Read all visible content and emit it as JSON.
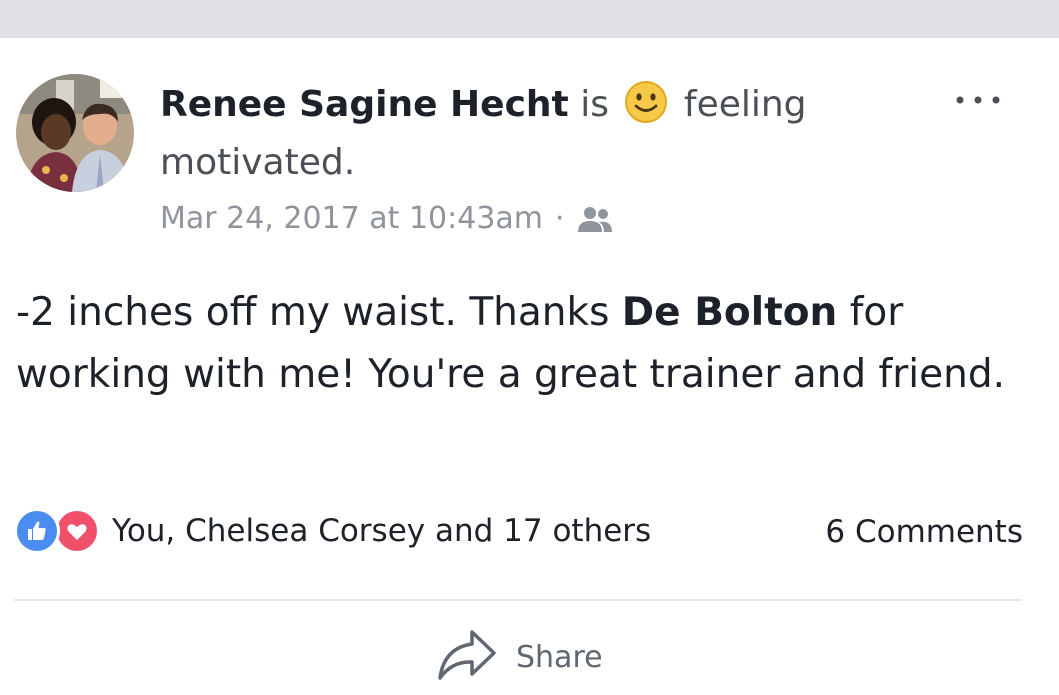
{
  "post": {
    "author": "Renee Sagine Hecht",
    "verb": "is",
    "feeling_text": "feeling motivated.",
    "timestamp": "Mar 24, 2017 at 10:43am",
    "separator": "·",
    "privacy_icon": "friends-icon",
    "text_before_mention": "-2 inches off my waist. Thanks ",
    "mention": "De Bolton",
    "text_after_mention": " for working with me! You're a great trainer and friend.",
    "reactions": {
      "icons": [
        "like-icon",
        "love-icon"
      ],
      "summary": "You, Chelsea Corsey and 17 others"
    },
    "comments_label": "6 Comments",
    "actions": {
      "share_label": "Share"
    }
  },
  "colors": {
    "like": "#4a8cf0",
    "love": "#f0506a",
    "meta": "#90949c",
    "text": "#1d2129"
  }
}
